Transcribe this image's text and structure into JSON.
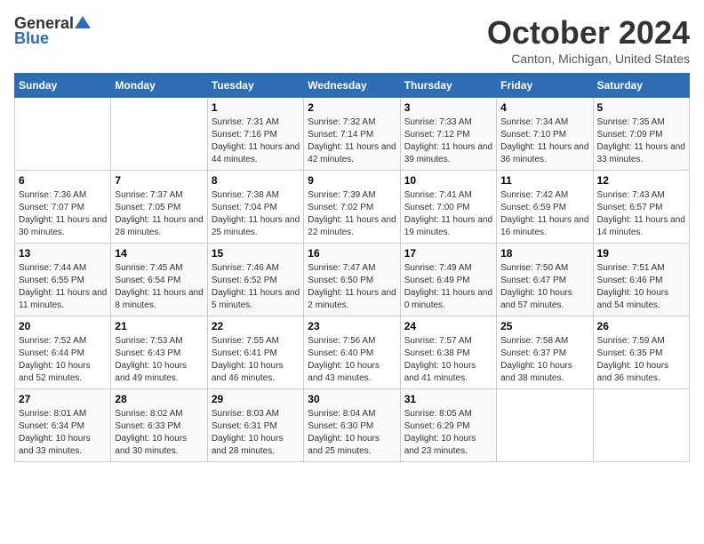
{
  "header": {
    "logo_general": "General",
    "logo_blue": "Blue",
    "month_title": "October 2024",
    "location": "Canton, Michigan, United States"
  },
  "days_of_week": [
    "Sunday",
    "Monday",
    "Tuesday",
    "Wednesday",
    "Thursday",
    "Friday",
    "Saturday"
  ],
  "weeks": [
    {
      "days": [
        {
          "num": "",
          "info": ""
        },
        {
          "num": "",
          "info": ""
        },
        {
          "num": "1",
          "info": "Sunrise: 7:31 AM\nSunset: 7:16 PM\nDaylight: 11 hours and 44 minutes."
        },
        {
          "num": "2",
          "info": "Sunrise: 7:32 AM\nSunset: 7:14 PM\nDaylight: 11 hours and 42 minutes."
        },
        {
          "num": "3",
          "info": "Sunrise: 7:33 AM\nSunset: 7:12 PM\nDaylight: 11 hours and 39 minutes."
        },
        {
          "num": "4",
          "info": "Sunrise: 7:34 AM\nSunset: 7:10 PM\nDaylight: 11 hours and 36 minutes."
        },
        {
          "num": "5",
          "info": "Sunrise: 7:35 AM\nSunset: 7:09 PM\nDaylight: 11 hours and 33 minutes."
        }
      ]
    },
    {
      "days": [
        {
          "num": "6",
          "info": "Sunrise: 7:36 AM\nSunset: 7:07 PM\nDaylight: 11 hours and 30 minutes."
        },
        {
          "num": "7",
          "info": "Sunrise: 7:37 AM\nSunset: 7:05 PM\nDaylight: 11 hours and 28 minutes."
        },
        {
          "num": "8",
          "info": "Sunrise: 7:38 AM\nSunset: 7:04 PM\nDaylight: 11 hours and 25 minutes."
        },
        {
          "num": "9",
          "info": "Sunrise: 7:39 AM\nSunset: 7:02 PM\nDaylight: 11 hours and 22 minutes."
        },
        {
          "num": "10",
          "info": "Sunrise: 7:41 AM\nSunset: 7:00 PM\nDaylight: 11 hours and 19 minutes."
        },
        {
          "num": "11",
          "info": "Sunrise: 7:42 AM\nSunset: 6:59 PM\nDaylight: 11 hours and 16 minutes."
        },
        {
          "num": "12",
          "info": "Sunrise: 7:43 AM\nSunset: 6:57 PM\nDaylight: 11 hours and 14 minutes."
        }
      ]
    },
    {
      "days": [
        {
          "num": "13",
          "info": "Sunrise: 7:44 AM\nSunset: 6:55 PM\nDaylight: 11 hours and 11 minutes."
        },
        {
          "num": "14",
          "info": "Sunrise: 7:45 AM\nSunset: 6:54 PM\nDaylight: 11 hours and 8 minutes."
        },
        {
          "num": "15",
          "info": "Sunrise: 7:46 AM\nSunset: 6:52 PM\nDaylight: 11 hours and 5 minutes."
        },
        {
          "num": "16",
          "info": "Sunrise: 7:47 AM\nSunset: 6:50 PM\nDaylight: 11 hours and 2 minutes."
        },
        {
          "num": "17",
          "info": "Sunrise: 7:49 AM\nSunset: 6:49 PM\nDaylight: 11 hours and 0 minutes."
        },
        {
          "num": "18",
          "info": "Sunrise: 7:50 AM\nSunset: 6:47 PM\nDaylight: 10 hours and 57 minutes."
        },
        {
          "num": "19",
          "info": "Sunrise: 7:51 AM\nSunset: 6:46 PM\nDaylight: 10 hours and 54 minutes."
        }
      ]
    },
    {
      "days": [
        {
          "num": "20",
          "info": "Sunrise: 7:52 AM\nSunset: 6:44 PM\nDaylight: 10 hours and 52 minutes."
        },
        {
          "num": "21",
          "info": "Sunrise: 7:53 AM\nSunset: 6:43 PM\nDaylight: 10 hours and 49 minutes."
        },
        {
          "num": "22",
          "info": "Sunrise: 7:55 AM\nSunset: 6:41 PM\nDaylight: 10 hours and 46 minutes."
        },
        {
          "num": "23",
          "info": "Sunrise: 7:56 AM\nSunset: 6:40 PM\nDaylight: 10 hours and 43 minutes."
        },
        {
          "num": "24",
          "info": "Sunrise: 7:57 AM\nSunset: 6:38 PM\nDaylight: 10 hours and 41 minutes."
        },
        {
          "num": "25",
          "info": "Sunrise: 7:58 AM\nSunset: 6:37 PM\nDaylight: 10 hours and 38 minutes."
        },
        {
          "num": "26",
          "info": "Sunrise: 7:59 AM\nSunset: 6:35 PM\nDaylight: 10 hours and 36 minutes."
        }
      ]
    },
    {
      "days": [
        {
          "num": "27",
          "info": "Sunrise: 8:01 AM\nSunset: 6:34 PM\nDaylight: 10 hours and 33 minutes."
        },
        {
          "num": "28",
          "info": "Sunrise: 8:02 AM\nSunset: 6:33 PM\nDaylight: 10 hours and 30 minutes."
        },
        {
          "num": "29",
          "info": "Sunrise: 8:03 AM\nSunset: 6:31 PM\nDaylight: 10 hours and 28 minutes."
        },
        {
          "num": "30",
          "info": "Sunrise: 8:04 AM\nSunset: 6:30 PM\nDaylight: 10 hours and 25 minutes."
        },
        {
          "num": "31",
          "info": "Sunrise: 8:05 AM\nSunset: 6:29 PM\nDaylight: 10 hours and 23 minutes."
        },
        {
          "num": "",
          "info": ""
        },
        {
          "num": "",
          "info": ""
        }
      ]
    }
  ]
}
